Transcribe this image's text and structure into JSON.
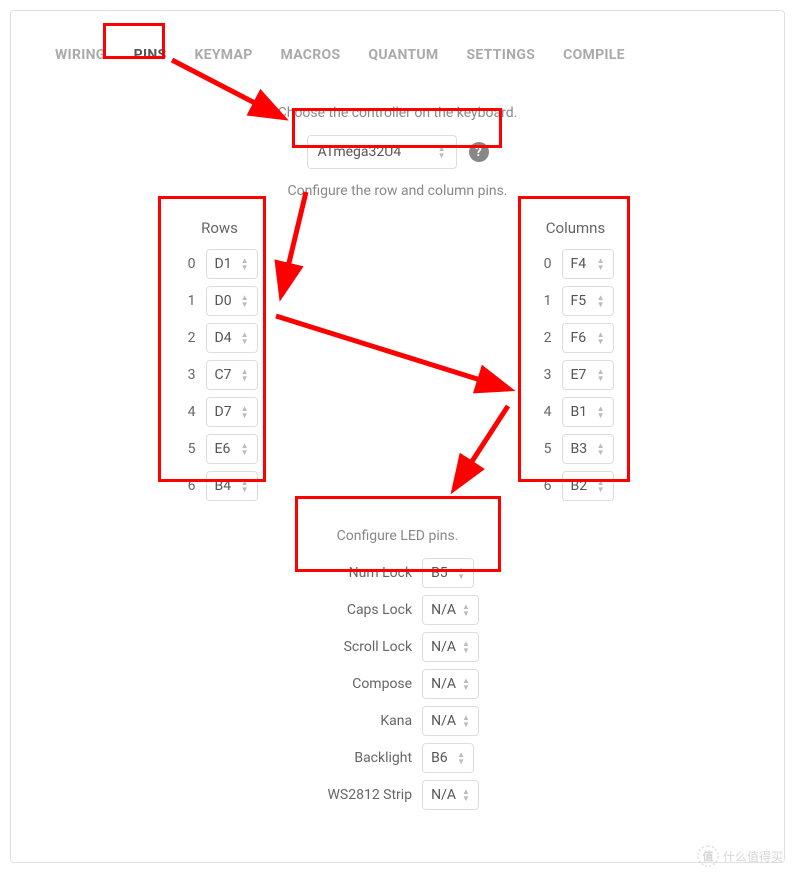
{
  "tabs": {
    "wiring": "WIRING",
    "pins": "PINS",
    "keymap": "KEYMAP",
    "macros": "MACROS",
    "quantum": "QUANTUM",
    "settings": "SETTINGS",
    "compile": "COMPILE"
  },
  "controller": {
    "label": "Choose the controller on the keyboard.",
    "value": "ATmega32U4"
  },
  "pins_label": "Configure the row and column pins.",
  "rows": {
    "title": "Rows",
    "items": [
      {
        "idx": "0",
        "val": "D1"
      },
      {
        "idx": "1",
        "val": "D0"
      },
      {
        "idx": "2",
        "val": "D4"
      },
      {
        "idx": "3",
        "val": "C7"
      },
      {
        "idx": "4",
        "val": "D7"
      },
      {
        "idx": "5",
        "val": "E6"
      },
      {
        "idx": "6",
        "val": "B4"
      }
    ]
  },
  "cols": {
    "title": "Columns",
    "items": [
      {
        "idx": "0",
        "val": "F4"
      },
      {
        "idx": "1",
        "val": "F5"
      },
      {
        "idx": "2",
        "val": "F6"
      },
      {
        "idx": "3",
        "val": "E7"
      },
      {
        "idx": "4",
        "val": "B1"
      },
      {
        "idx": "5",
        "val": "B3"
      },
      {
        "idx": "6",
        "val": "B2"
      }
    ]
  },
  "leds": {
    "label": "Configure LED pins.",
    "items": [
      {
        "name": "Num Lock",
        "val": "B5"
      },
      {
        "name": "Caps Lock",
        "val": "N/A"
      },
      {
        "name": "Scroll Lock",
        "val": "N/A"
      },
      {
        "name": "Compose",
        "val": "N/A"
      },
      {
        "name": "Kana",
        "val": "N/A"
      },
      {
        "name": "Backlight",
        "val": "B6"
      },
      {
        "name": "WS2812 Strip",
        "val": "N/A"
      }
    ]
  },
  "watermark": {
    "badge": "值",
    "text": "什么值得买"
  }
}
